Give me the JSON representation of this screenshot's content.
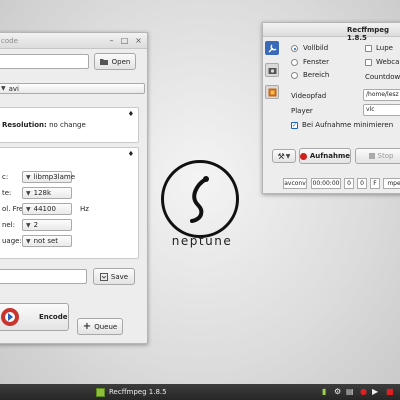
{
  "left_window": {
    "title": "code",
    "open_label": "Open",
    "format_value": "avi",
    "resolution_label": "Resolution:",
    "resolution_value": "no change",
    "audio_rows": [
      {
        "label": "c:",
        "value": "libmp3lame",
        "unit": ""
      },
      {
        "label": "te:",
        "value": "128k",
        "unit": ""
      },
      {
        "label": "ol. Freq:",
        "value": "44100",
        "unit": "Hz"
      },
      {
        "label": "nel:",
        "value": "2",
        "unit": ""
      },
      {
        "label": "uage:",
        "value": "not set",
        "unit": ""
      }
    ],
    "save_label": "Save",
    "encode_label": "Encode",
    "queue_label": "Queue"
  },
  "logo": {
    "text": "neptune"
  },
  "right_window": {
    "title": "Recffmpeg 1.8.5",
    "capture": {
      "vollbild": "Vollbild",
      "fenster": "Fenster",
      "bereich": "Bereich",
      "lupe": "Lupe",
      "webcam": "Webcam",
      "countdown": "Countdown"
    },
    "videopfad_label": "Videopfad",
    "videopfad_value": "/home/lesz",
    "player_label": "Player",
    "player_value": "vlc",
    "minimize_label": "Bei Aufnahme minimieren",
    "record_label": "Aufnahme",
    "stop_label": "Stop",
    "status": {
      "encoder": "avconv",
      "time": "00:00:00",
      "n1": "0",
      "n2": "0",
      "f": "F",
      "ext": "mpe"
    }
  },
  "taskbar": {
    "item_label": "Recffmpeg 1.8.5"
  },
  "colors": {
    "record_red": "#d0201b",
    "encode_red": "#c9342c",
    "accent_blue": "#1f63c6"
  }
}
